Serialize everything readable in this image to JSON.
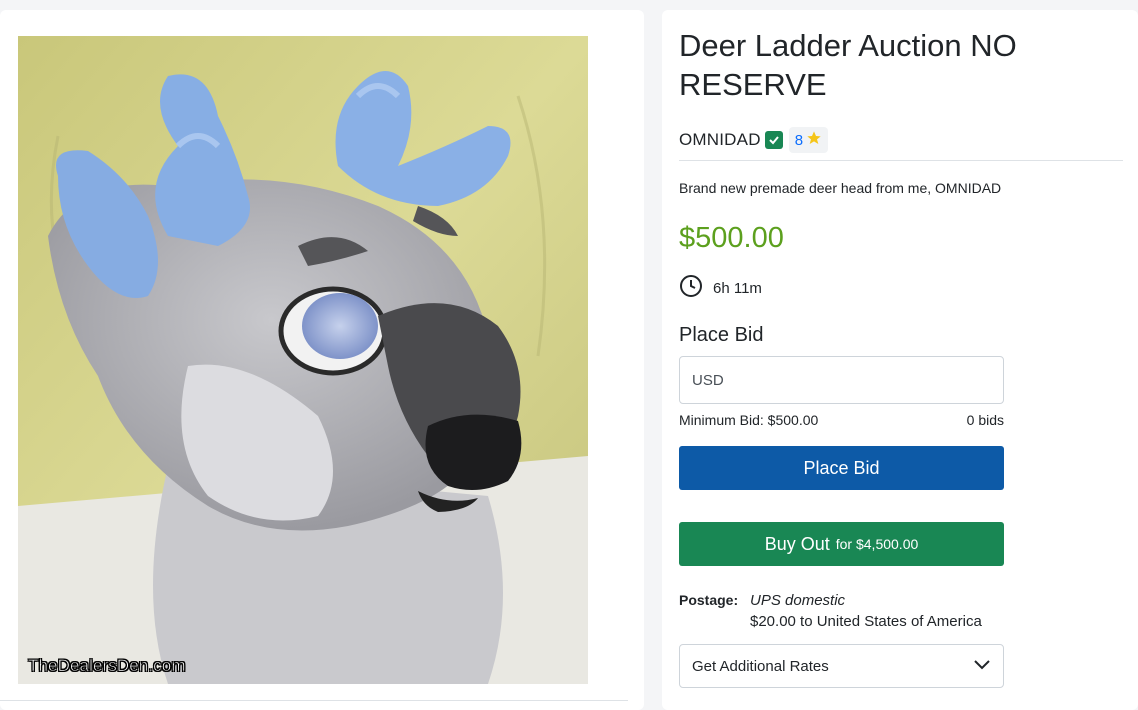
{
  "listing": {
    "title": "Deer Ladder Auction NO RESERVE",
    "watermark": "TheDealersDen.com",
    "seller": {
      "name": "OMNIDAD",
      "verified": true,
      "rating": "8"
    },
    "description": "Brand new premade deer head from me, OMNIDAD",
    "price": "$500.00",
    "time_remaining": "6h 11m",
    "colors": {
      "price": "#5ca01e",
      "bid_button": "#0d5aa7",
      "buy_button": "#198754",
      "verified": "#198754",
      "rating_num": "#0d6efd",
      "star": "#f5c518"
    }
  },
  "bid": {
    "heading": "Place Bid",
    "input_placeholder": "USD",
    "min_bid": "Minimum Bid: $500.00",
    "bid_count": "0 bids",
    "button_label": "Place Bid"
  },
  "buyout": {
    "label": "Buy Out",
    "for_text": "for $4,500.00"
  },
  "postage": {
    "label": "Postage:",
    "method": "UPS domestic",
    "cost": "$20.00 to United States of America",
    "rates_label": "Get Additional Rates"
  },
  "icons": {
    "verified": "check-square-icon",
    "rating": "star-icon",
    "time": "clock-icon",
    "rates": "chevron-down-icon"
  }
}
